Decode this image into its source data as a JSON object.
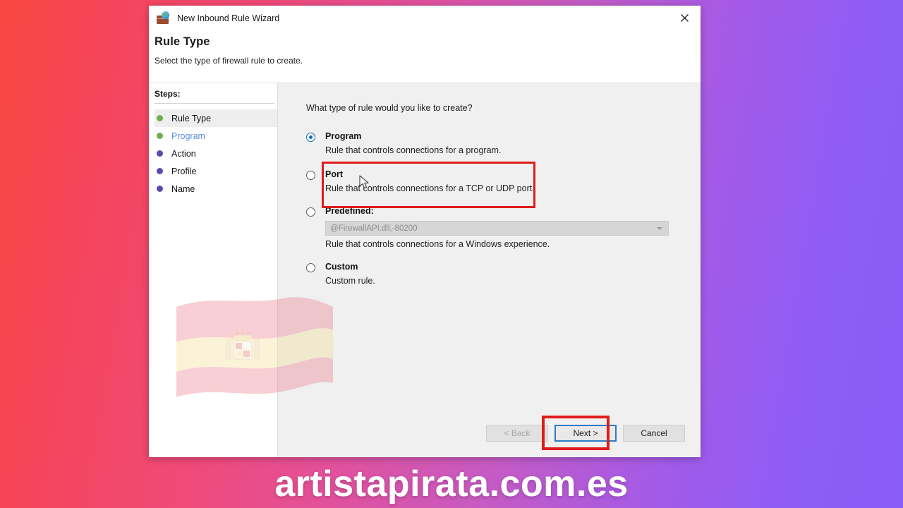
{
  "window": {
    "title": "New Inbound Rule Wizard",
    "icon": "firewall-globe-icon",
    "close_label": "✕"
  },
  "header": {
    "title": "Rule Type",
    "subtitle": "Select the type of firewall rule to create."
  },
  "steps": {
    "label": "Steps:",
    "items": [
      {
        "label": "Rule Type",
        "bullet_color": "#6ab04c",
        "state": "active"
      },
      {
        "label": "Program",
        "bullet_color": "#6ab04c",
        "state": "link"
      },
      {
        "label": "Action",
        "bullet_color": "#5b4bb0",
        "state": "pending"
      },
      {
        "label": "Profile",
        "bullet_color": "#5b4bb0",
        "state": "pending"
      },
      {
        "label": "Name",
        "bullet_color": "#5b4bb0",
        "state": "pending"
      }
    ]
  },
  "main": {
    "question": "What type of rule would you like to create?",
    "options": [
      {
        "id": "program",
        "title": "Program",
        "description": "Rule that controls connections for a program.",
        "selected": true,
        "highlighted": true
      },
      {
        "id": "port",
        "title": "Port",
        "description": "Rule that controls connections for a TCP or UDP port.",
        "selected": false,
        "highlighted": false
      },
      {
        "id": "predefined",
        "title": "Predefined:",
        "description": "Rule that controls connections for a Windows experience.",
        "selected": false,
        "highlighted": false,
        "combo_value": "@FirewallAPI.dll,-80200"
      },
      {
        "id": "custom",
        "title": "Custom",
        "description": "Custom rule.",
        "selected": false,
        "highlighted": false
      }
    ]
  },
  "footer": {
    "back_label": "< Back",
    "next_label": "Next >",
    "cancel_label": "Cancel",
    "back_disabled": true,
    "next_focused": true,
    "next_highlighted": true
  },
  "overlay": {
    "watermark_text": "artistapirata.com.es",
    "flag": "spain-waving-flag",
    "annotation_color": "#e01b1b",
    "cursor": "arrow-cursor"
  },
  "colors": {
    "accent_blue": "#0a6cbd",
    "focus_blue": "#2b7cc4",
    "annotation_red": "#e01b1b",
    "bg_gradient_start": "#f8463f",
    "bg_gradient_end": "#8a5cf8"
  }
}
